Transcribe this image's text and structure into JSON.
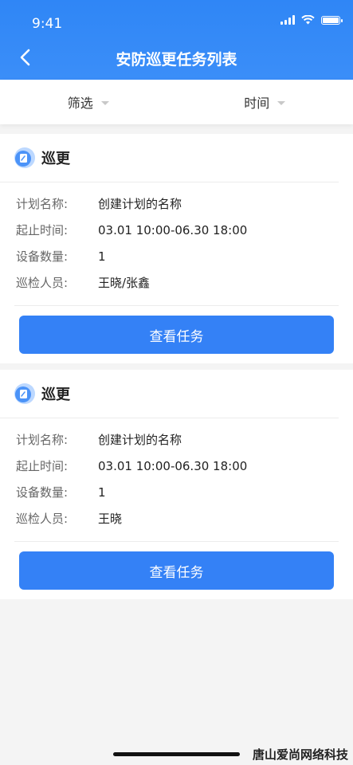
{
  "status_bar": {
    "time": "9:41"
  },
  "header": {
    "title": "安防巡更任务列表"
  },
  "filters": [
    {
      "label": "筛选"
    },
    {
      "label": "时间"
    }
  ],
  "tasks": [
    {
      "title": "巡更",
      "fields": [
        {
          "label": "计划名称:",
          "value": "创建计划的名称"
        },
        {
          "label": "起止时间:",
          "value": "03.01 10:00-06.30 18:00"
        },
        {
          "label": "设备数量:",
          "value": "1"
        },
        {
          "label": "巡检人员:",
          "value": "王晓/张鑫"
        }
      ],
      "button": "查看任务"
    },
    {
      "title": "巡更",
      "fields": [
        {
          "label": "计划名称:",
          "value": "创建计划的名称"
        },
        {
          "label": "起止时间:",
          "value": "03.01 10:00-06.30 18:00"
        },
        {
          "label": "设备数量:",
          "value": "1"
        },
        {
          "label": "巡检人员:",
          "value": "王晓"
        }
      ],
      "button": "查看任务"
    }
  ],
  "watermark": "唐山爱尚网络科技",
  "colors": {
    "primary": "#3481f6",
    "header": "#2f86f6",
    "background": "#f4f4f4"
  },
  "icons": [
    "back-arrow-icon",
    "signal-icon",
    "wifi-icon",
    "battery-icon",
    "caret-down-icon",
    "task-doc-icon"
  ]
}
